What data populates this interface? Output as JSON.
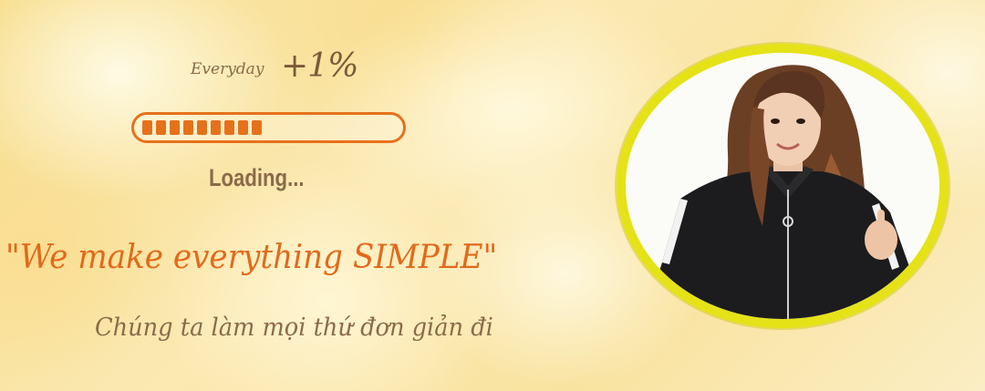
{
  "banner": {
    "everyday_label": "Everyday",
    "progress_increment": "+1%",
    "progress": {
      "segments_filled": 9,
      "fill_color": "#e6711b",
      "track_color": "#e6711b"
    },
    "loading_label": "Loading...",
    "slogan": "\"We make everything SIMPLE\"",
    "sub_slogan": "Chúng ta làm mọi thứ đơn giản đi",
    "colors": {
      "accent_orange": "#e2691a",
      "text_brown": "#8a6a4a",
      "ring_yellow": "#e5e218"
    },
    "photo": {
      "icon": "person-portrait-icon"
    }
  }
}
